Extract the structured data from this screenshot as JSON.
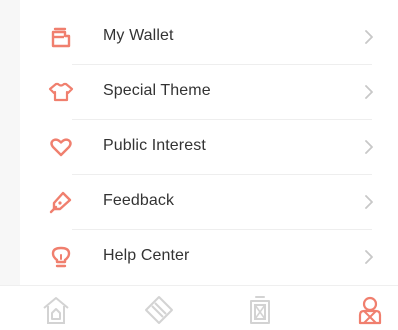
{
  "colors": {
    "accent": "#F07F6E",
    "text": "#333333",
    "chevron": "#C8C8C8",
    "tab_inactive": "#D3D3D3",
    "divider": "#EEEEEE"
  },
  "menu": {
    "items": [
      {
        "label": "My Wallet",
        "icon": "wallet-icon"
      },
      {
        "label": "Special Theme",
        "icon": "shirt-icon"
      },
      {
        "label": "Public Interest",
        "icon": "heart-icon"
      },
      {
        "label": "Feedback",
        "icon": "pen-icon"
      },
      {
        "label": "Help Center",
        "icon": "lightbulb-icon"
      }
    ]
  },
  "tabbar": {
    "tabs": [
      {
        "icon": "home-icon",
        "active": false
      },
      {
        "icon": "discover-icon",
        "active": false
      },
      {
        "icon": "box-icon",
        "active": false
      },
      {
        "icon": "profile-icon",
        "active": true
      }
    ]
  }
}
